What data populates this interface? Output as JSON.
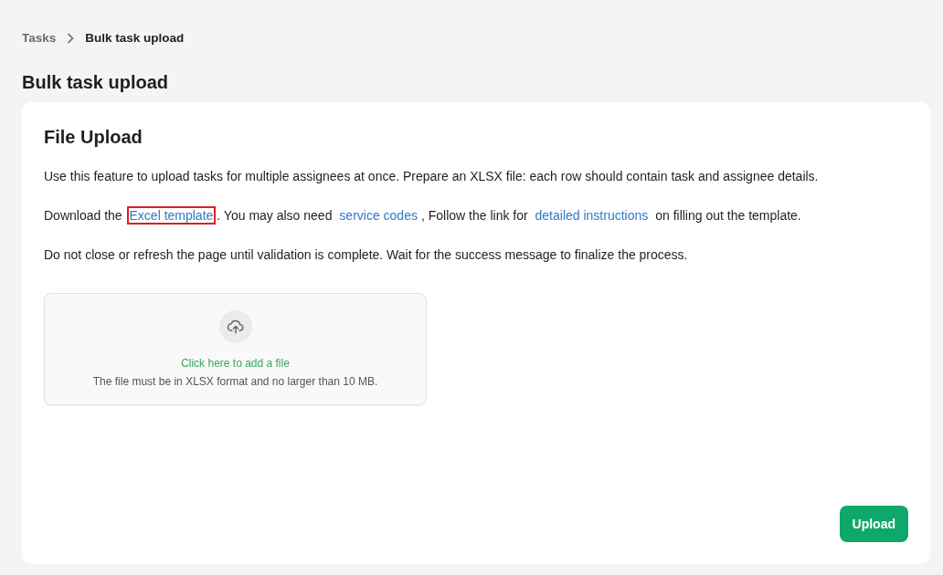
{
  "breadcrumb": [
    {
      "label": "Tasks",
      "current": false
    },
    {
      "label": "Bulk task upload",
      "current": true
    }
  ],
  "page_title": "Bulk task upload",
  "card": {
    "title": "File Upload",
    "paragraphs": [
      [
        {
          "kind": "text",
          "text": "Use this feature to upload tasks for multiple assignees at once. Prepare an XLSX file: each row should contain task and assignee details."
        }
      ],
      [
        {
          "kind": "text",
          "text": "Download the "
        },
        {
          "kind": "link",
          "text": "Excel template",
          "highlighted": true
        },
        {
          "kind": "text",
          "text": ". You may also need "
        },
        {
          "kind": "link",
          "text": "service codes",
          "highlighted": false
        },
        {
          "kind": "text",
          "text": ", Follow the link for "
        },
        {
          "kind": "link",
          "text": "detailed instructions",
          "highlighted": false
        },
        {
          "kind": "text",
          "text": " on filling out the template."
        }
      ],
      [
        {
          "kind": "text",
          "text": "Do not close or refresh the page until validation is complete. Wait for the success message to finalize the process."
        }
      ]
    ],
    "dropzone": {
      "action": "Click here to add a file",
      "hint": "The file must be in XLSX format and no larger than 10 MB."
    },
    "button": "Upload"
  }
}
